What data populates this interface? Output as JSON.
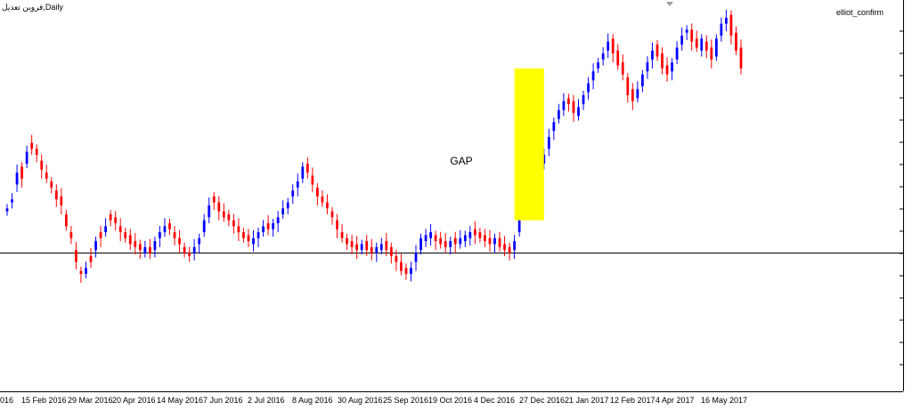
{
  "window": {
    "title": "فروین تعدیل,Daily",
    "indicator": "elliot_confirm",
    "annotation": "GAP"
  },
  "colors": {
    "bull": "#0000ff",
    "bear": "#ff0000",
    "gap_box": "#ffff00",
    "hline": "#000000",
    "background": "#ffffff"
  },
  "xaxis": {
    "ticks": [
      "016",
      "15 Feb 2016",
      "29 Mar 2016",
      "20 Apr 2016",
      "14 May 2016",
      "7 Jun 2016",
      "2 Jul 2016",
      "8 Aug 2016",
      "30 Aug 2016",
      "25 Sep 2016",
      "19 Oct 2016",
      "4 Dec 2016",
      "27 Dec 2016",
      "21 Jan 2017",
      "12 Feb 2017",
      "4 Apr 2017",
      "16 May 2017"
    ]
  },
  "chart_data": {
    "type": "candlestick",
    "title": "فروین تعدیل,Daily",
    "note": "Relative price levels (0-100 scale, y-axis values not printed in screenshot)",
    "horizontal_line": 33,
    "gap": {
      "from_index": 103,
      "to_index": 109,
      "low": 44,
      "high": 95,
      "label": "GAP"
    },
    "close": [
      48,
      51,
      60,
      58,
      67,
      68,
      66,
      61,
      58,
      55,
      51,
      49,
      42,
      38,
      30,
      26,
      28,
      30,
      37,
      38,
      42,
      44,
      43,
      40,
      38,
      36,
      35,
      34,
      35,
      33,
      37,
      40,
      42,
      41,
      38,
      36,
      33,
      32,
      35,
      38,
      44,
      49,
      50,
      47,
      45,
      44,
      42,
      40,
      38,
      37,
      38,
      40,
      42,
      41,
      43,
      45,
      48,
      50,
      54,
      57,
      62,
      60,
      56,
      52,
      50,
      48,
      45,
      41,
      38,
      36,
      35,
      34,
      36,
      34,
      33,
      35,
      36,
      34,
      32,
      30,
      27,
      26,
      28,
      33,
      38,
      39,
      40,
      37,
      36,
      35,
      37,
      36,
      38,
      39,
      40,
      39,
      38,
      37,
      36,
      38,
      35,
      34,
      33,
      37,
      44,
      50,
      55,
      59,
      62,
      66,
      72,
      77,
      81,
      84,
      83,
      80,
      82,
      86,
      90,
      94,
      97,
      100,
      104,
      100,
      96,
      93,
      86,
      84,
      88,
      93,
      97,
      101,
      99,
      95,
      93,
      97,
      102,
      106,
      108,
      104,
      102,
      105,
      101,
      98,
      105,
      110,
      112,
      106,
      101,
      95
    ],
    "open": [
      47,
      50,
      56,
      62,
      63,
      70,
      68,
      64,
      60,
      57,
      54,
      52,
      46,
      40,
      34,
      27,
      26,
      32,
      34,
      40,
      40,
      46,
      45,
      42,
      40,
      39,
      37,
      36,
      33,
      35,
      34,
      38,
      40,
      43,
      40,
      38,
      35,
      33,
      33,
      36,
      40,
      45,
      52,
      50,
      47,
      46,
      44,
      42,
      40,
      39,
      36,
      38,
      40,
      43,
      41,
      43,
      46,
      48,
      52,
      55,
      58,
      63,
      59,
      55,
      52,
      50,
      47,
      44,
      40,
      38,
      37,
      36,
      34,
      37,
      35,
      33,
      34,
      37,
      35,
      32,
      30,
      28,
      26,
      30,
      34,
      37,
      38,
      39,
      38,
      37,
      35,
      38,
      36,
      37,
      38,
      41,
      40,
      39,
      38,
      36,
      38,
      36,
      35,
      34,
      40,
      46,
      51,
      56,
      60,
      63,
      68,
      74,
      78,
      81,
      85,
      84,
      79,
      83,
      87,
      91,
      95,
      98,
      101,
      105,
      101,
      97,
      92,
      88,
      85,
      89,
      94,
      98,
      103,
      100,
      96,
      94,
      98,
      103,
      107,
      108,
      105,
      101,
      104,
      102,
      99,
      106,
      110,
      113,
      107,
      102
    ]
  }
}
